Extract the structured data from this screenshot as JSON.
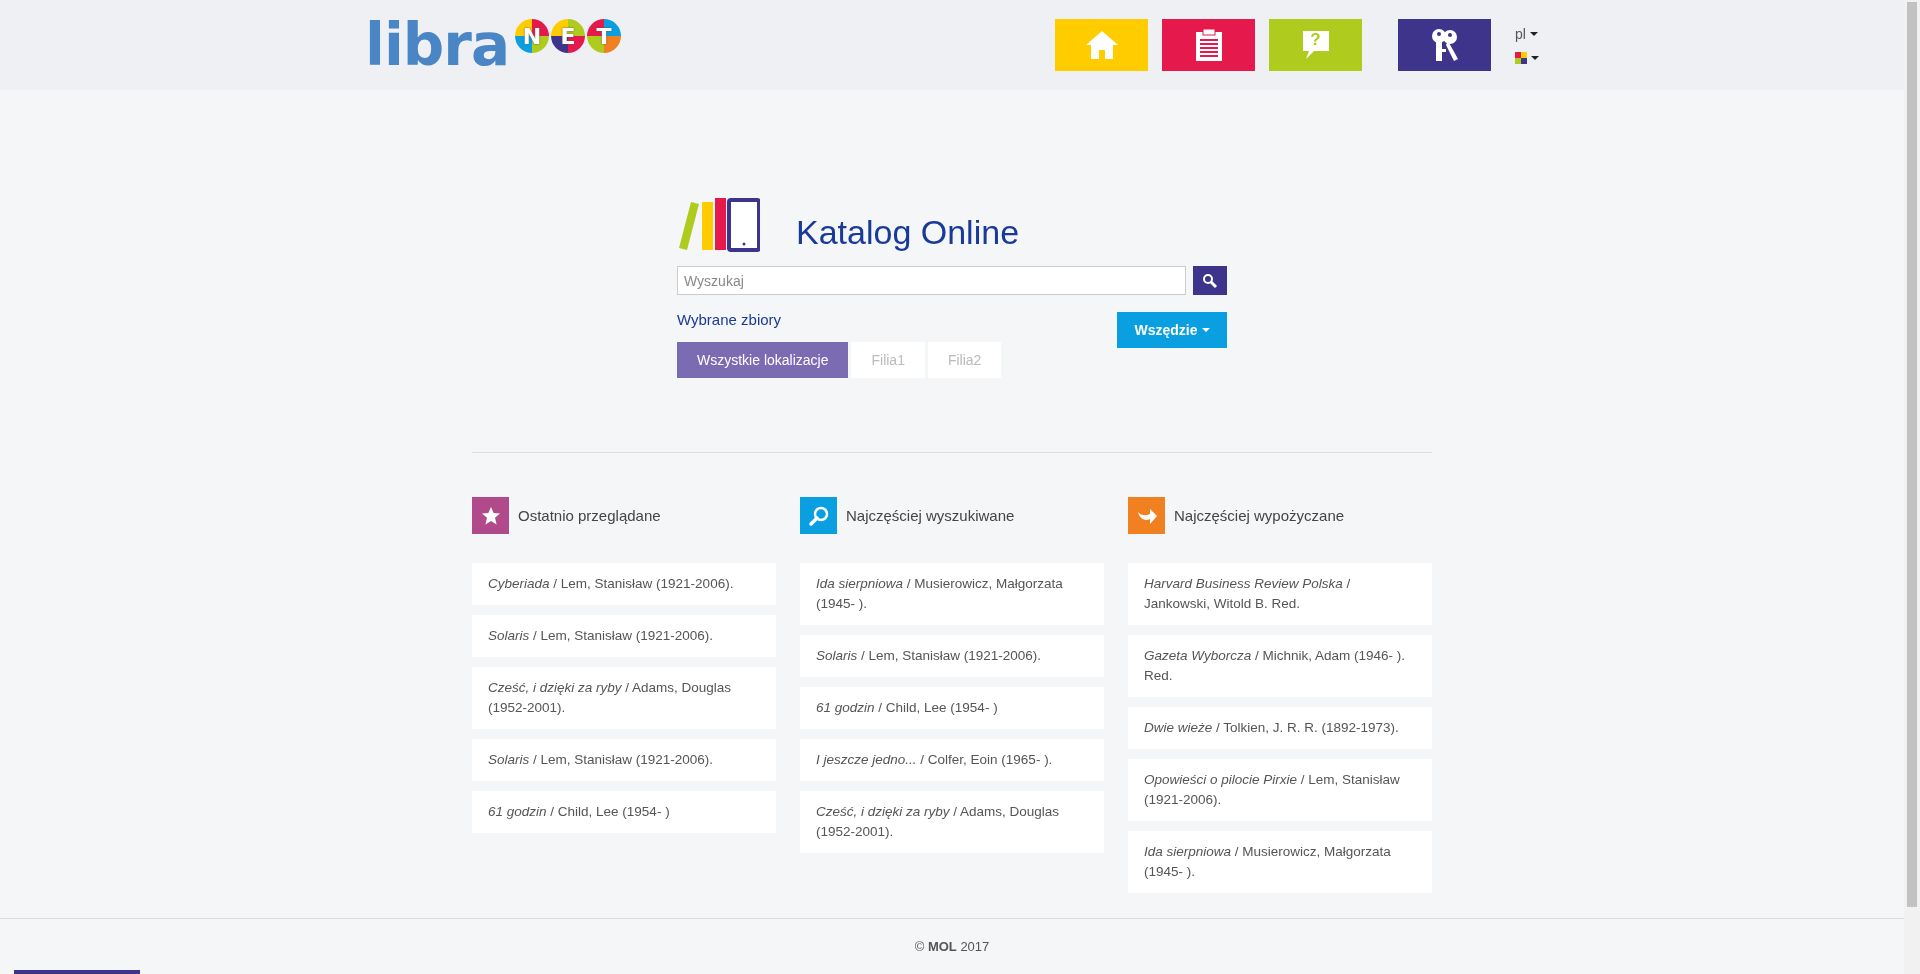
{
  "header": {
    "logo": {
      "text": "libra",
      "badges": [
        {
          "letter": "N"
        },
        {
          "letter": "E"
        },
        {
          "letter": "T"
        }
      ]
    },
    "nav": [
      {
        "kind": "home",
        "color": "#ffcc00"
      },
      {
        "kind": "clipboard",
        "color": "#e5194b"
      },
      {
        "kind": "help",
        "color": "#aecb1e",
        "symbol": "?"
      },
      {
        "kind": "keys",
        "color": "#3f348c"
      }
    ],
    "language": "pl"
  },
  "catalog": {
    "title": "Katalog Online",
    "search": {
      "placeholder": "Wyszukaj"
    },
    "collections_label": "Wybrane zbiory",
    "scope_button": "Wszędzie",
    "tabs": [
      {
        "label": "Wszystkie lokalizacje",
        "selected": true
      },
      {
        "label": "Filia1",
        "selected": false
      },
      {
        "label": "Filia2",
        "selected": false
      }
    ]
  },
  "sections": [
    {
      "kind": "recent",
      "color": "#b04a8a",
      "title": "Ostatnio przeglądane",
      "items": [
        "*Cyberiada* / Lem, Stanisław (1921-2006).",
        "*Solaris* / Lem, Stanisław (1921-2006).",
        "*Cześć, i dzięki za ryby* / Adams, Douglas (1952-2001).",
        "*Solaris* / Lem, Stanisław (1921-2006).",
        "*61 godzin* / Child, Lee (1954- )"
      ]
    },
    {
      "kind": "searched",
      "color": "#0a9fe0",
      "title": "Najczęściej wyszukiwane",
      "items": [
        "*Ida sierpniowa* / Musierowicz, Małgorzata (1945- ).",
        "*Solaris* / Lem, Stanisław (1921-2006).",
        "*61 godzin* / Child, Lee (1954- )",
        "*I jeszcze jedno...* / Colfer, Eoin (1965- ).",
        "*Cześć, i dzięki za ryby* / Adams, Douglas (1952-2001)."
      ]
    },
    {
      "kind": "borrowed",
      "color": "#f08020",
      "title": "Najczęściej wypożyczane",
      "items": [
        "*Harvard Business Review Polska* / Jankowski, Witold B. Red.",
        "*Gazeta Wyborcza* / Michnik, Adam (1946- ). Red.",
        "*Dwie wieże* / Tolkien, J. R. R. (1892-1973).",
        "*Opowieści o pilocie Pirxie* / Lem, Stanisław (1921-2006).",
        "*Ida sierpniowa* / Musierowicz, Małgorzata (1945- )."
      ]
    }
  ],
  "footer": "© **MOL** 2017"
}
